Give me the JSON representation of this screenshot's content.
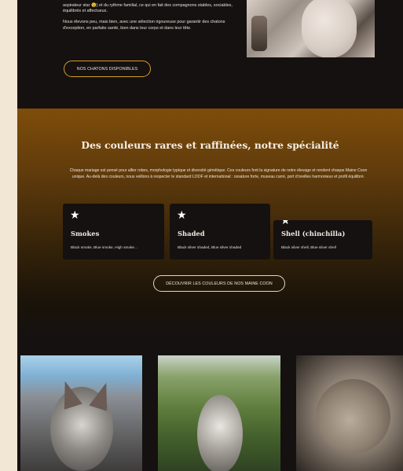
{
  "intro": {
    "line1": "aspirateur star 😉) et du rythme familial, ce qui en fait des compagnons stables, sociables, équilibrés et affectueux.",
    "line2": "Nous élevons peu, mais bien, avec une sélection rigoureuse pour garantir des chatons d'exception, en parfaite santé, bien dans leur corps et dans leur tête.",
    "button": "NOS CHATONS DISPONIBLES"
  },
  "colors_section": {
    "title": "Des couleurs rares et raffinées, notre spécialité",
    "description": "Chaque mariage est pensé pour allier robes, morphologie typique et diversité génétique. Ces couleurs font la signature de notre élevage et rendent chaque Maine Coon unique. Au-delà des couleurs, nous veillons à respecter le standard LOOF et international : ossature forte, museau carré, port d'oreilles harmonieux et profil équilibré.",
    "cards": [
      {
        "icon": "star-icon",
        "title": "Smokes",
        "text": "Black smoke, Blue smoke, High smoke..."
      },
      {
        "icon": "star-icon",
        "title": "Shaded",
        "text": "Black silver shaded, Blue silver shaded"
      },
      {
        "icon": "star-icon",
        "title": "Shell (chinchilla)",
        "text": "Black silver shell, Blue silver shell"
      }
    ],
    "button": "DÉCOUVRIR LES COULEURS DE NOS MAINE COON"
  },
  "colors": {
    "accent": "#d69a2a",
    "page_bg": "#151110",
    "outer_bg": "#f2e6d5"
  }
}
